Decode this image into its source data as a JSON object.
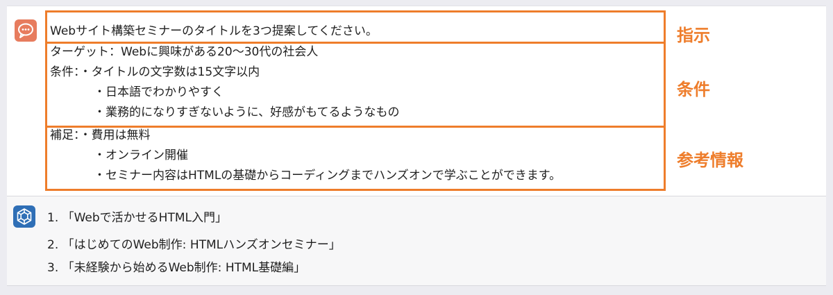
{
  "user_message": {
    "avatar_icon": "chat-bubble-icon",
    "instruction": "Webサイト構築セミナーのタイトルを3つ提案してください。",
    "conditions": [
      "ターゲット：Webに興味がある20〜30代の社会人",
      "条件：・タイトルの文字数は15文字以内",
      "・日本語でわかりやすく",
      "・業務的になりすぎないように、好感がもてるようなもの"
    ],
    "reference": [
      "補足：・費用は無料",
      "・オンライン開催",
      "・セミナー内容はHTMLの基礎からコーディングまでハンズオンで学ぶことができます。"
    ]
  },
  "annotations": {
    "instruction_label": "指示",
    "conditions_label": "条件",
    "reference_label": "参考情報",
    "color": "#ee7d2b"
  },
  "assistant_message": {
    "avatar_icon": "openai-logo-icon",
    "items": [
      "1. 「Webで活かせるHTML入門」",
      "2. 「はじめてのWeb制作: HTMLハンズオンセミナー」",
      "3. 「未経験から始めるWeb制作: HTML基礎編」"
    ]
  }
}
